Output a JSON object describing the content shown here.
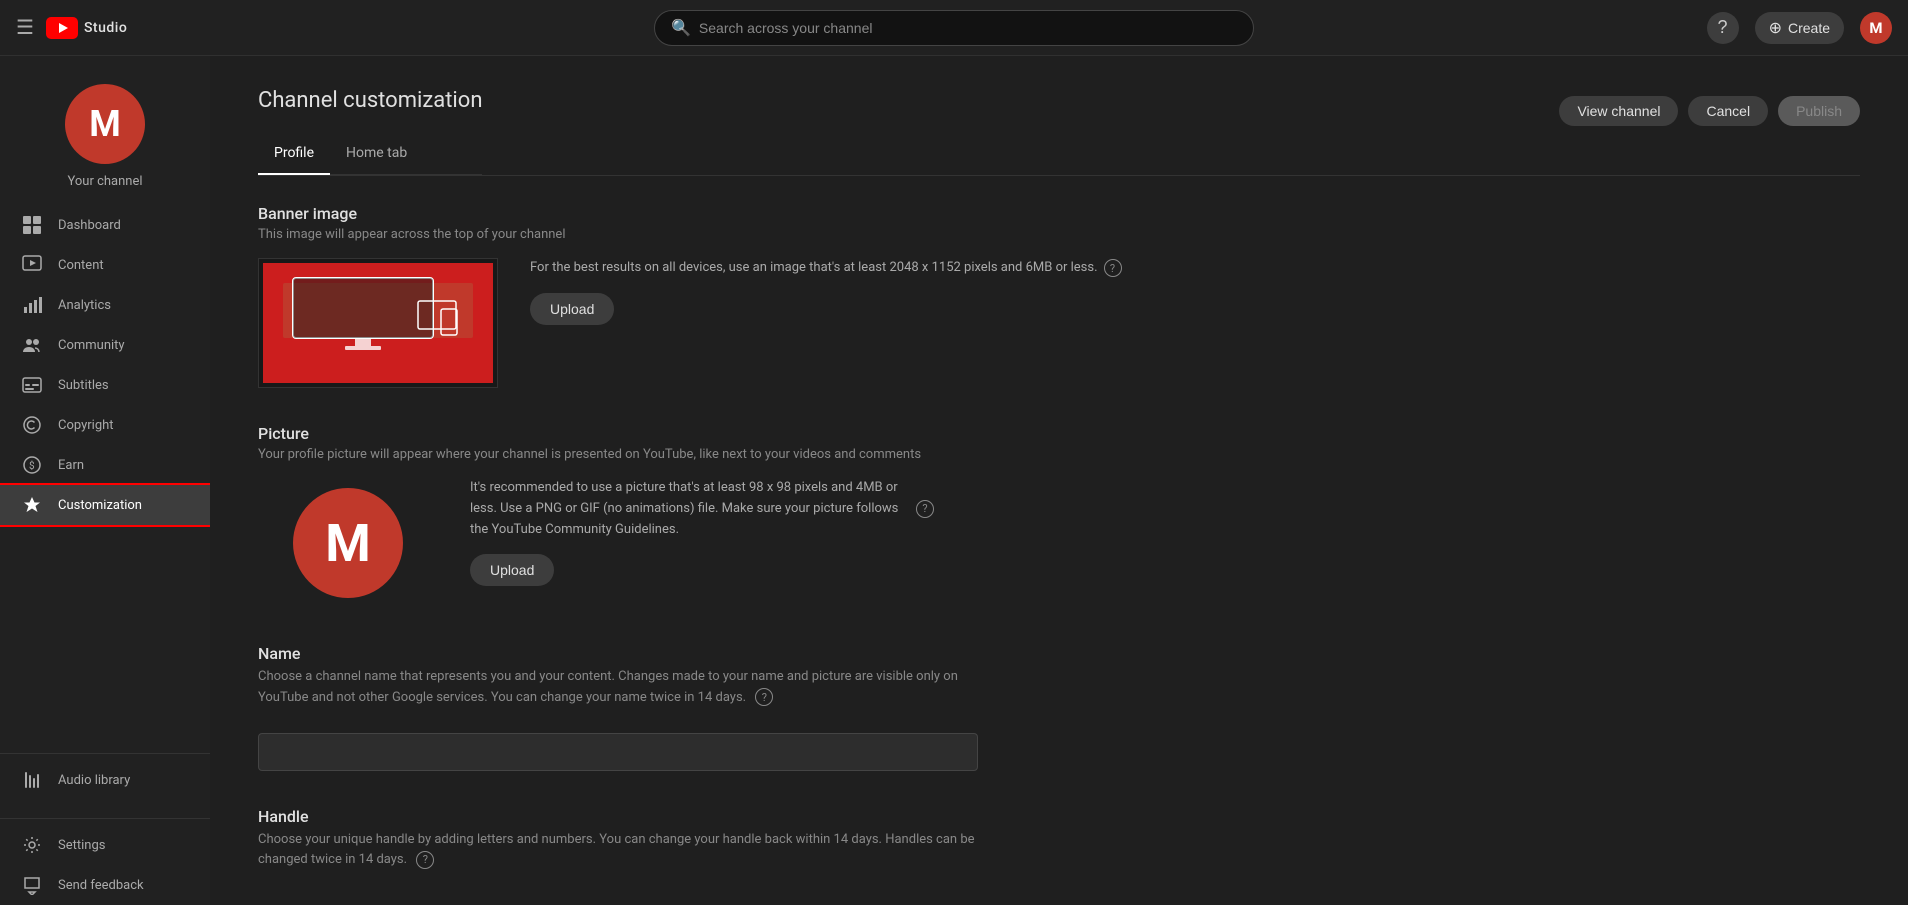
{
  "app": {
    "title": "YouTube Studio",
    "logo_text": "Studio"
  },
  "topnav": {
    "search_placeholder": "Search across your channel",
    "create_label": "Create",
    "help_icon": "?",
    "avatar_letter": "M"
  },
  "sidebar": {
    "avatar_letter": "M",
    "channel_label": "Your channel",
    "items": [
      {
        "id": "dashboard",
        "label": "Dashboard",
        "icon": "⊞"
      },
      {
        "id": "content",
        "label": "Content",
        "icon": "▶"
      },
      {
        "id": "analytics",
        "label": "Analytics",
        "icon": "📊"
      },
      {
        "id": "community",
        "label": "Community",
        "icon": "👥"
      },
      {
        "id": "subtitles",
        "label": "Subtitles",
        "icon": "💬"
      },
      {
        "id": "copyright",
        "label": "Copyright",
        "icon": "©"
      },
      {
        "id": "earn",
        "label": "Earn",
        "icon": "$"
      },
      {
        "id": "customization",
        "label": "Customization",
        "icon": "✦",
        "active": true
      }
    ],
    "bottom_items": [
      {
        "id": "audio_library",
        "label": "Audio library",
        "icon": "🎵"
      },
      {
        "id": "settings",
        "label": "Settings",
        "icon": "⚙"
      },
      {
        "id": "send_feedback",
        "label": "Send feedback",
        "icon": "⚑"
      }
    ]
  },
  "page": {
    "title": "Channel customization",
    "tabs": [
      {
        "id": "profile",
        "label": "Profile",
        "active": true
      },
      {
        "id": "hometab",
        "label": "Home tab",
        "active": false
      }
    ],
    "actions": {
      "view_channel": "View channel",
      "cancel": "Cancel",
      "publish": "Publish"
    }
  },
  "sections": {
    "banner": {
      "title": "Banner image",
      "description": "This image will appear across the top of your channel",
      "info_text": "For the best results on all devices, use an image that's at least 2048 x 1152 pixels and 6MB or less.",
      "upload_label": "Upload"
    },
    "picture": {
      "title": "Picture",
      "description": "Your profile picture will appear where your channel is presented on YouTube, like next to your videos and comments",
      "info_text": "It's recommended to use a picture that's at least 98 x 98 pixels and 4MB or less. Use a PNG or GIF (no animations) file. Make sure your picture follows the YouTube Community Guidelines.",
      "upload_label": "Upload",
      "avatar_letter": "M"
    },
    "name": {
      "title": "Name",
      "description": "Choose a channel name that represents you and your content. Changes made to your name and picture are visible only on YouTube and not other Google services. You can change your name twice in 14 days.",
      "input_placeholder": "",
      "input_value": ""
    },
    "handle": {
      "title": "Handle",
      "description": "Choose your unique handle by adding letters and numbers. You can change your handle back within 14 days. Handles can be changed twice in 14 days."
    }
  }
}
